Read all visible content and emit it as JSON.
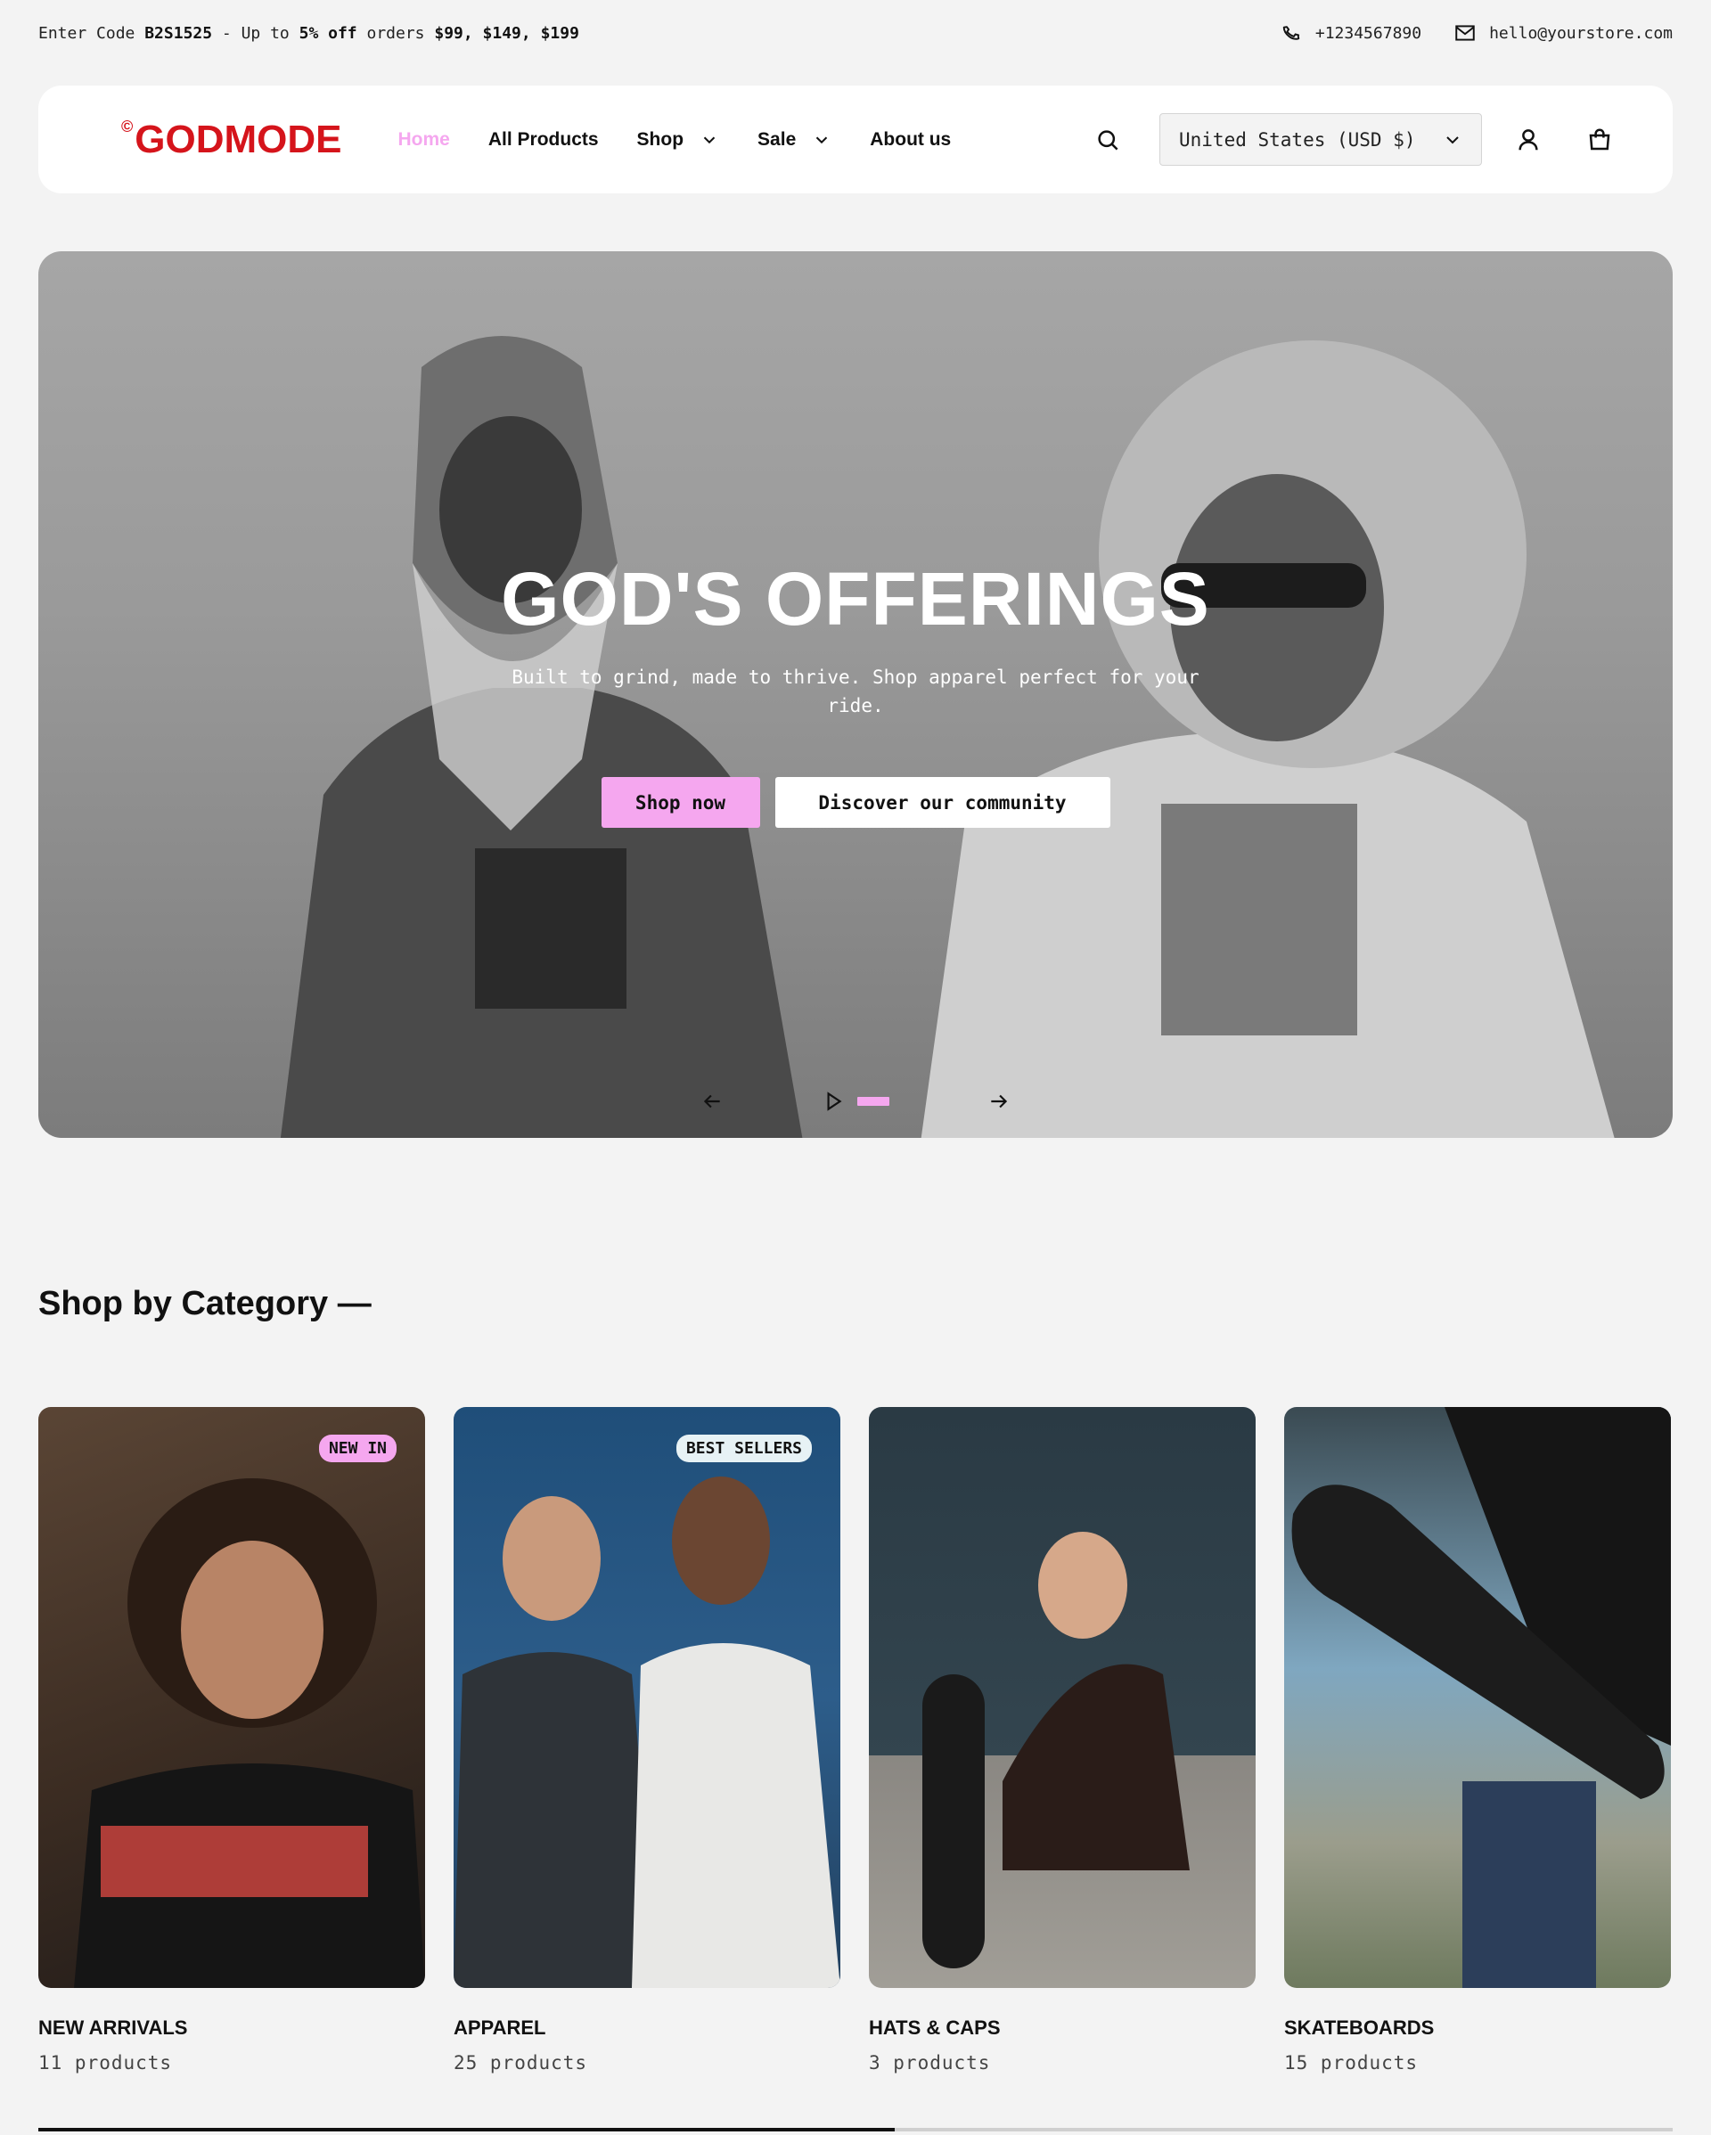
{
  "announcement": {
    "prefix": "Enter Code ",
    "code": "B2S1525",
    "middle": " - Up to ",
    "discount": "5% off",
    "suffix": " orders ",
    "tiers": "$99, $149, $199",
    "phone": "+1234567890",
    "email": "hello@yourstore.com"
  },
  "header": {
    "logo_mark": "©",
    "logo_text": "GODMODE",
    "nav": {
      "home": "Home",
      "all_products": "All Products",
      "shop": "Shop",
      "sale": "Sale",
      "about": "About us"
    },
    "country_selector": "United States (USD $)"
  },
  "hero": {
    "title": "GOD'S OFFERINGS",
    "subtitle": "Built to grind, made to thrive. Shop apparel perfect for your ride.",
    "primary_button": "Shop now",
    "secondary_button": "Discover our community",
    "slide_progress": 1.0
  },
  "categories": {
    "title": "Shop by Category —",
    "items": [
      {
        "name": "NEW ARRIVALS",
        "count": "11 products",
        "badge": "NEW IN"
      },
      {
        "name": "APPAREL",
        "count": "25 products",
        "badge": "BEST SELLERS"
      },
      {
        "name": "HATS & CAPS",
        "count": "3 products",
        "badge": ""
      },
      {
        "name": "SKATEBOARDS",
        "count": "15 products",
        "badge": ""
      }
    ],
    "scroll_progress": 0.524
  },
  "colors": {
    "accent_pink": "#f5a7ef",
    "brand_red": "#d5141b",
    "background": "#f3f3f3"
  },
  "icons": [
    "phone-icon",
    "mail-icon",
    "search-icon",
    "user-icon",
    "cart-icon",
    "chevron-down-icon",
    "arrow-left-icon",
    "arrow-right-icon",
    "play-icon"
  ]
}
